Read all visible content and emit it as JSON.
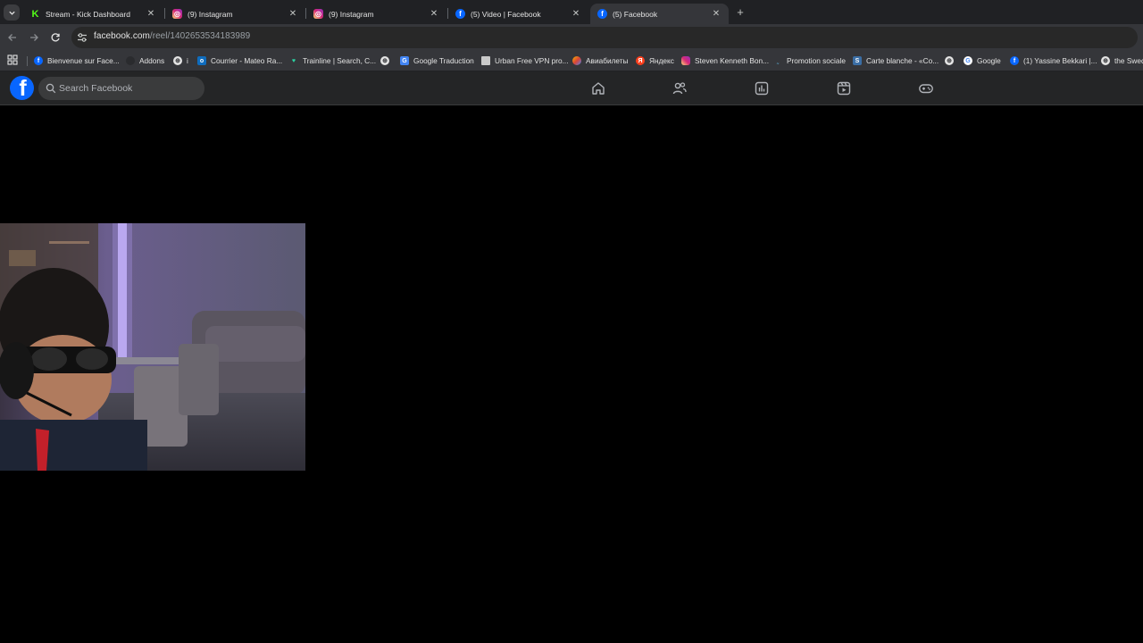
{
  "tabs": [
    {
      "title": "Stream - Kick Dashboard",
      "favicon": "kick-icon",
      "color": "#53fc18"
    },
    {
      "title": "(9) Instagram",
      "favicon": "instagram-icon",
      "color": "#d6249f"
    },
    {
      "title": "(9) Instagram",
      "favicon": "instagram-icon",
      "color": "#d6249f"
    },
    {
      "title": "(5) Video | Facebook",
      "favicon": "facebook-icon",
      "color": "#0866ff"
    },
    {
      "title": "(5) Facebook",
      "favicon": "facebook-icon",
      "color": "#0866ff",
      "active": true
    }
  ],
  "address_bar": {
    "host": "facebook.com",
    "path": "/reel/1402653534183989"
  },
  "bookmarks": [
    {
      "label": "Bienvenue sur Face...",
      "icon": "facebook-icon"
    },
    {
      "label": "Addons",
      "icon": "cube-icon"
    },
    {
      "label": "i",
      "icon": "globe-icon"
    },
    {
      "label": "Courrier - Mateo Ra...",
      "icon": "outlook-icon"
    },
    {
      "label": "Trainline | Search, C...",
      "icon": "trainline-icon"
    },
    {
      "label": "",
      "icon": "globe-icon"
    },
    {
      "label": "Google Traduction",
      "icon": "translate-icon"
    },
    {
      "label": "Urban Free VPN pro...",
      "icon": "vpn-icon"
    },
    {
      "label": "Авиабилеты",
      "icon": "plane-icon"
    },
    {
      "label": "Яндекс",
      "icon": "yandex-icon"
    },
    {
      "label": "Steven Kenneth Bon...",
      "icon": "instagram-icon"
    },
    {
      "label": "Promotion sociale",
      "icon": "promo-icon"
    },
    {
      "label": "Carte blanche - «Co...",
      "icon": "s-icon"
    },
    {
      "label": "",
      "icon": "globe-icon"
    },
    {
      "label": "Google",
      "icon": "google-icon"
    },
    {
      "label": "(1) Yassine Bekkari |...",
      "icon": "facebook-icon"
    },
    {
      "label": "the Swed",
      "icon": "globe-icon"
    }
  ],
  "facebook": {
    "search_placeholder": "Search Facebook",
    "nav": [
      "home-icon",
      "friends-icon",
      "dashboard-icon",
      "reels-icon",
      "gaming-icon"
    ]
  },
  "colors": {
    "tabstrip": "#202124",
    "toolbar": "#35363a",
    "fb_header": "#242526",
    "fb_blue": "#0866ff"
  }
}
